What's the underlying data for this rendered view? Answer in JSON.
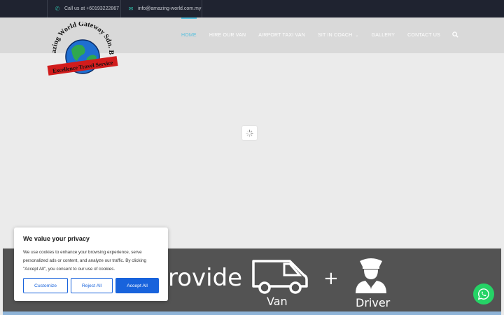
{
  "topbar": {
    "phone": "Call us at +60193222867",
    "email": "info@amazing-world.com.my"
  },
  "logo": {
    "arc_text": "Amazing World Gateway Sdn. Bhd.",
    "tagline": "Excellence Travel Service"
  },
  "nav": {
    "items": [
      {
        "label": "HOME",
        "active": true
      },
      {
        "label": "HIRE OUR VAN"
      },
      {
        "label": "AIRPORT TAXI VAN"
      },
      {
        "label": "SIT IN COACH"
      },
      {
        "label": "GALLERY"
      },
      {
        "label": "CONTACT US"
      }
    ]
  },
  "banner": {
    "provide": "rovide",
    "van": "Van",
    "plus": "+",
    "driver": "Driver"
  },
  "cookie": {
    "title": "We value your privacy",
    "body": "We use cookies to enhance your browsing experience, serve personalized ads or content, and analyze our traffic. By clicking \"Accept All\", you consent to our use of cookies.",
    "customize": "Customize",
    "reject": "Reject All",
    "accept": "Accept All"
  },
  "colors": {
    "topbar": "#1f2330",
    "accent": "#5bc0de",
    "cookie_blue": "#1863dc",
    "whatsapp": "#25d366"
  }
}
